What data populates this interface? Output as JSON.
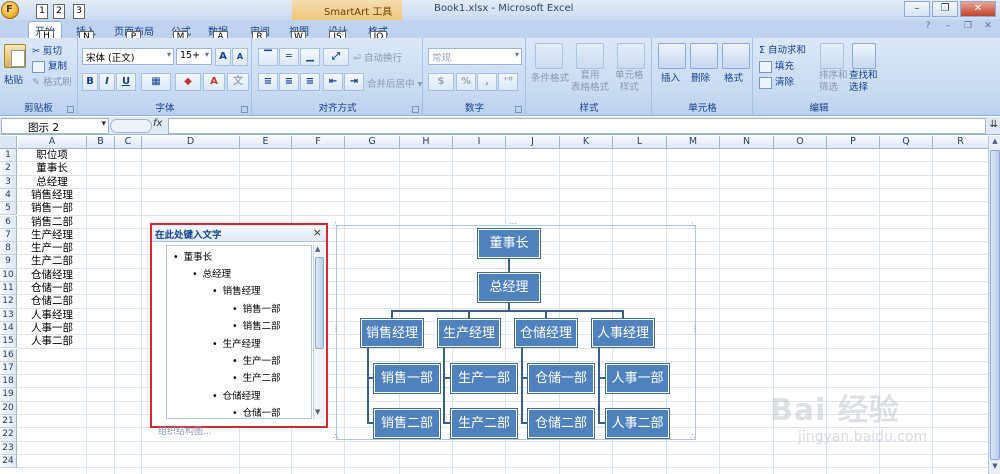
{
  "window": {
    "doc_title": "Book1.xlsx - Microsoft Excel",
    "context_tab": "SmartArt 工具",
    "office_key": "F",
    "qat_keys": [
      "1",
      "2",
      "3"
    ]
  },
  "tabs": [
    {
      "label": "开始",
      "key": "H"
    },
    {
      "label": "插入",
      "key": "N"
    },
    {
      "label": "页面布局",
      "key": "P"
    },
    {
      "label": "公式",
      "key": "M"
    },
    {
      "label": "数据",
      "key": "A"
    },
    {
      "label": "审阅",
      "key": "R"
    },
    {
      "label": "视图",
      "key": "W"
    },
    {
      "label": "设计",
      "key": "JS"
    },
    {
      "label": "格式",
      "key": "JO"
    }
  ],
  "ribbon": {
    "clipboard": {
      "label": "剪贴板",
      "paste": "粘贴",
      "cut": "剪切",
      "copy": "复制",
      "format_painter": "格式刷"
    },
    "font": {
      "label": "字体",
      "name": "宋体 (正文)",
      "size": "15+",
      "grow": "A",
      "shrink": "A",
      "bold": "B",
      "italic": "I",
      "underline": "U"
    },
    "alignment": {
      "label": "对齐方式",
      "wrap": "自动换行",
      "merge": "合并后居中"
    },
    "number": {
      "label": "数字",
      "format": "常规",
      "percent": "%",
      "comma": ","
    },
    "styles": {
      "label": "样式",
      "conditional": "条件格式",
      "table": "套用\n表格格式",
      "cell": "单元格\n样式"
    },
    "cells": {
      "label": "单元格",
      "insert": "插入",
      "delete": "删除",
      "format": "格式"
    },
    "editing": {
      "label": "编辑",
      "autosum": "Σ 自动求和",
      "fill": "填充",
      "clear": "清除",
      "sort": "排序和\n筛选",
      "find": "查找和\n选择"
    }
  },
  "formula_bar": {
    "name_box": "图示 2",
    "fx": "fx",
    "formula": ""
  },
  "grid": {
    "columns": [
      "A",
      "B",
      "C",
      "D",
      "E",
      "F",
      "G",
      "H",
      "I",
      "J",
      "K",
      "L",
      "M",
      "N",
      "O",
      "P",
      "Q",
      "R"
    ],
    "rows": [
      "1",
      "2",
      "3",
      "4",
      "5",
      "6",
      "7",
      "8",
      "9",
      "10",
      "11",
      "12",
      "13",
      "14",
      "15",
      "16",
      "17",
      "18",
      "19",
      "20",
      "21",
      "22",
      "23",
      "24"
    ],
    "column_a": [
      "职位项",
      "董事长",
      "总经理",
      "销售经理",
      "销售一部",
      "销售二部",
      "生产经理",
      "生产一部",
      "生产二部",
      "仓储经理",
      "仓储一部",
      "仓储二部",
      "人事经理",
      "人事一部",
      "人事二部"
    ]
  },
  "text_pane": {
    "title": "在此处键入文字",
    "close": "×",
    "items": [
      {
        "text": "董事长",
        "level": 1
      },
      {
        "text": "总经理",
        "level": 2
      },
      {
        "text": "销售经理",
        "level": 3
      },
      {
        "text": "销售一部",
        "level": 4
      },
      {
        "text": "销售二部",
        "level": 4
      },
      {
        "text": "生产经理",
        "level": 3
      },
      {
        "text": "生产一部",
        "level": 4
      },
      {
        "text": "生产二部",
        "level": 4
      },
      {
        "text": "仓储经理",
        "level": 3
      },
      {
        "text": "仓储一部",
        "level": 4
      }
    ],
    "footer_link": "组织结构图..."
  },
  "org_chart": {
    "root": "董事长",
    "level2": "总经理",
    "managers": [
      "销售经理",
      "生产经理",
      "仓储经理",
      "人事经理"
    ],
    "depts": [
      [
        "销售一部",
        "销售二部"
      ],
      [
        "生产一部",
        "生产二部"
      ],
      [
        "仓储一部",
        "仓储二部"
      ],
      [
        "人事一部",
        "人事二部"
      ]
    ],
    "node_color": "#4f81bd",
    "connector_color": "#3a5f8f"
  },
  "watermark": {
    "brand": "Bai 经验",
    "url": "jingyan.baidu.com"
  }
}
